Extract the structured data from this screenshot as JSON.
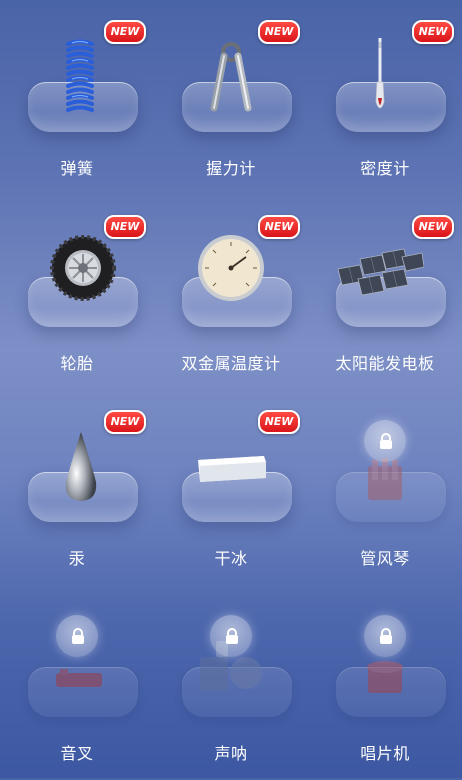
{
  "badge_text": "NEW",
  "items": [
    {
      "label": "弹簧",
      "icon": "spring-icon",
      "new": true,
      "locked": false
    },
    {
      "label": "握力计",
      "icon": "hand-grip-icon",
      "new": true,
      "locked": false
    },
    {
      "label": "密度计",
      "icon": "hydrometer-icon",
      "new": true,
      "locked": false
    },
    {
      "label": "轮胎",
      "icon": "tire-icon",
      "new": true,
      "locked": false
    },
    {
      "label": "双金属温度计",
      "icon": "bimetal-thermometer-icon",
      "new": true,
      "locked": false
    },
    {
      "label": "太阳能发电板",
      "icon": "solar-panel-icon",
      "new": true,
      "locked": false
    },
    {
      "label": "汞",
      "icon": "mercury-drop-icon",
      "new": true,
      "locked": false
    },
    {
      "label": "干冰",
      "icon": "dry-ice-icon",
      "new": true,
      "locked": false
    },
    {
      "label": "管风琴",
      "icon": "lock-icon",
      "new": false,
      "locked": true
    },
    {
      "label": "音叉",
      "icon": "lock-icon",
      "new": false,
      "locked": true
    },
    {
      "label": "声呐",
      "icon": "lock-icon",
      "new": false,
      "locked": true
    },
    {
      "label": "唱片机",
      "icon": "lock-icon",
      "new": false,
      "locked": true
    }
  ]
}
